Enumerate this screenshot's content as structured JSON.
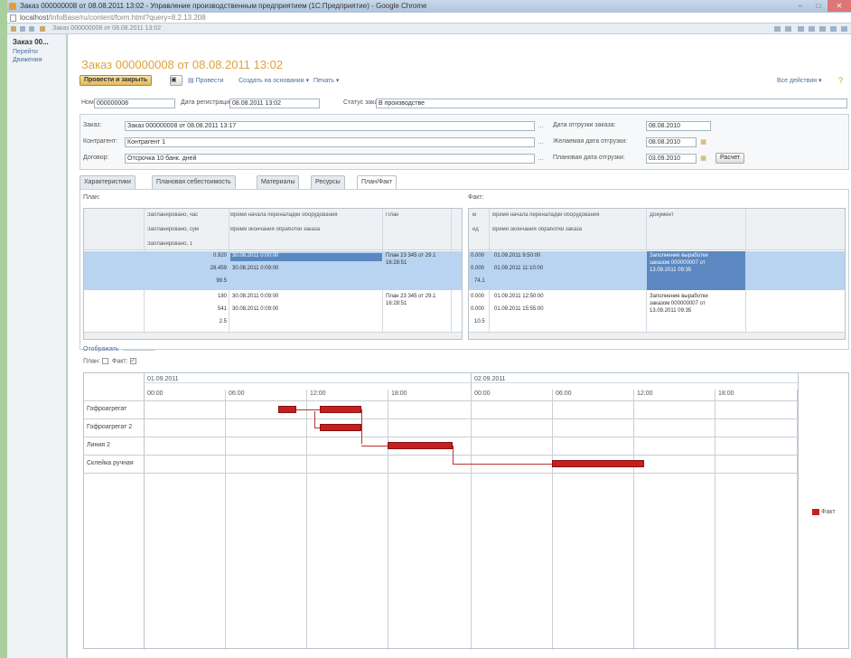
{
  "window": {
    "title": "Заказ 000000008 от 08.08.2011 13:02 - Управление производственным предприятием (1С:Предприятие) - Google Chrome",
    "url_host": "localhost",
    "url_path": "/InfoBase/ru/content/form.html?query=8.2.13.208",
    "tab_title": "Заказ 000000008 от 08.08.2011 13:02"
  },
  "sidebar": {
    "current": "Заказ 00...",
    "links": [
      "Перейти",
      "Движения"
    ]
  },
  "document": {
    "title": "Заказ 000000008 от 08.08.2011 13:02"
  },
  "toolbar": {
    "post_close": "Провести и закрыть",
    "post": "Провести",
    "create_based": "Создать на основании",
    "print": "Печать",
    "all_actions": "Все действия"
  },
  "header_fields": {
    "number_label": "Номер:",
    "number_value": "000000008",
    "reg_date_label": "Дата регистрации:",
    "reg_date_value": "08.08.2011 13:02",
    "status_label": "Статус заказа:",
    "status_value": "В производстве"
  },
  "panel": {
    "order_label": "Заказ:",
    "order_value": "Заказ 000000008 от 08.08.2011 13:17",
    "counterparty_label": "Контрагент:",
    "counterparty_value": "Контрагент 1",
    "contract_label": "Договор:",
    "contract_value": "Отсрочка 10 банк. дней",
    "ship_date_label": "Дата отгрузки заказа:",
    "ship_date_value": "08.08.2010",
    "wish_date_label": "Желаемая дата отгрузки:",
    "wish_date_value": "08.08.2010",
    "plan_date_label": "Плановая дата отгрузки:",
    "plan_date_value": "03.09.2010",
    "calc_button": "Расчет"
  },
  "tabs": [
    "Характеристики",
    "Плановая себестоимость",
    "Материалы",
    "Ресурсы",
    "План/Факт"
  ],
  "plan_table": {
    "section": "План:",
    "headers": [
      "Запланировано, час",
      "Запланировано, сум",
      "Запланировано, 1",
      "Время начала переналадки оборудования",
      "Время окончания обработки заказа",
      "План"
    ],
    "rows": [
      {
        "q": [
          "0.920",
          "28.459",
          "99.5"
        ],
        "t": [
          "30.08.2011 0:00:00",
          "30.08.2011 0:09:00"
        ],
        "p": [
          "План 23 345 от 29.1",
          "16:28:51"
        ]
      },
      {
        "q": [
          "180",
          "541",
          "2.5"
        ],
        "t": [
          "30.08.2011 0:09:00",
          "30.08.2011 0:09:00"
        ],
        "p": [
          "План 23 345 от 29.1",
          "16:28:51"
        ]
      }
    ]
  },
  "fact_table": {
    "section": "Факт:",
    "headers": [
      "м",
      "ед",
      "Время начала переналадки оборудования",
      "Время окончания обработки заказа",
      "Документ"
    ],
    "rows": [
      {
        "q": [
          "0.000",
          "0.000",
          "74.1"
        ],
        "t": [
          "01.09.2011 9:50:00",
          "01.09.2011 11:10:00"
        ],
        "d": [
          "Заполнение выработки",
          "заказом 000000007 от",
          "13.09.2011 09:35"
        ]
      },
      {
        "q": [
          "0.000",
          "0.000",
          "10.5"
        ],
        "t": [
          "01.09.2011 12:50:00",
          "01.09.2011 15:55:00"
        ],
        "d": [
          "Заполнение выработки",
          "заказом 000000007 от",
          "13.09.2011 09:35"
        ]
      }
    ]
  },
  "display": {
    "label": "Отображать",
    "plan": "План:",
    "fact": "Факт:"
  },
  "gantt": {
    "dates": [
      "01.09.2011",
      "02.09.2011"
    ],
    "hours": [
      "00:00",
      "06:00",
      "12:00",
      "18:00",
      "00:00",
      "06:00",
      "12:00",
      "18:00"
    ],
    "rows": [
      "Гофроагрегат",
      "Гофроагрегат 2",
      "Линия 2",
      "Склейка ручная"
    ],
    "legend": "Факт",
    "bar_color": "#c51f1f"
  }
}
